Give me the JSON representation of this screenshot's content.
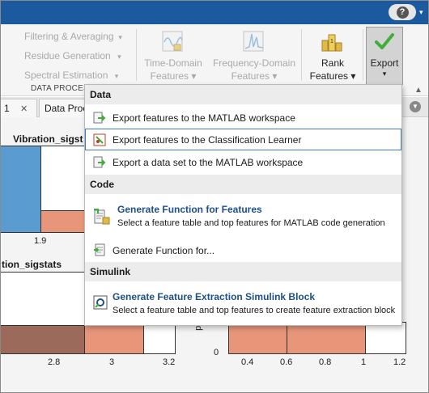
{
  "help": {
    "icon": "question-mark"
  },
  "toolstrip": {
    "left_items": [
      {
        "label": "Filtering & Averaging"
      },
      {
        "label": "Residue Generation"
      },
      {
        "label": "Spectral Estimation"
      }
    ],
    "section_label": "DATA PROCES",
    "time_domain": {
      "line1": "Time-Domain",
      "line2": "Features"
    },
    "freq_domain": {
      "line1": "Frequency-Domain",
      "line2": "Features"
    },
    "rank": {
      "line1": "Rank",
      "line2": "Features"
    },
    "export": {
      "label": "Export"
    }
  },
  "tabs": [
    {
      "label": "1"
    },
    {
      "label": "Data Proc"
    }
  ],
  "plots": {
    "top_title": "Vibration_sigst",
    "bottom_title": "tion_sigstats",
    "top_ticks": [
      "1.9"
    ],
    "bottom_ticks": [
      "2.8",
      "3",
      "3.2"
    ],
    "right_ticks_x": [
      "0.4",
      "0.6",
      "0.8",
      "1",
      "1.2"
    ],
    "right_tick_y": "0",
    "right_ylabel_fragment": "pr"
  },
  "menu": {
    "sections": {
      "data": "Data",
      "code": "Code",
      "simulink": "Simulink"
    },
    "items": {
      "export_workspace": "Export features to the MATLAB workspace",
      "export_classification": "Export features to the Classification Learner",
      "export_dataset": "Export a data set to the MATLAB workspace",
      "gen_function_title": "Generate Function for Features",
      "gen_function_desc": "Select a feature table and top features for MATLAB code generation",
      "gen_function_for": "Generate Function for...",
      "simulink_title": "Generate Feature Extraction Simulink Block",
      "simulink_desc": "Select a feature table and top features to create feature extraction block"
    }
  },
  "colors": {
    "title_bar": "#1c5aa0",
    "histogram_blue": "#5a9bd0",
    "histogram_orange": "#e8967a",
    "histogram_brown": "#9b6a5a",
    "link_blue": "#1d4f8c",
    "selection_border": "#3f78c4"
  }
}
